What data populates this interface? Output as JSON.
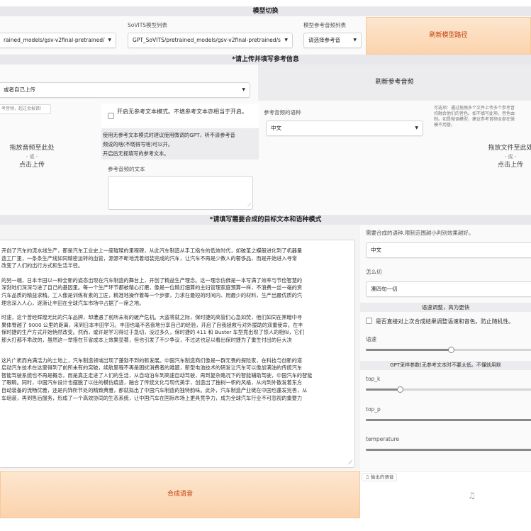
{
  "model_switch": {
    "header": "模型切换",
    "gpt_value": "rained_models/gsv-v2final-pretrained/",
    "sovits_label": "SoVITS模型列表",
    "sovits_value": "GPT_SoVITS/pretrained_models/gsv-v2final-pretrained/s",
    "ref_list_label": "模型参考音频列表",
    "ref_list_value": "请选择参考音",
    "refresh_models_button": "刷新模型路径"
  },
  "reference": {
    "header": "*请上传并填写参考信息",
    "dropdown_value": "或者自己上传",
    "refresh_ref_button": "刷新参考音频",
    "tooltip_text": "考音频，超过会报错！",
    "upload_main": "拖放音频至此处",
    "upload_or": "- 或 -",
    "upload_click": "点击上传",
    "no_ref_mode_label": "开启无参考文本模式。不填参考文本亦相当于开启。",
    "no_ref_info": [
      "使用无参考文本模式时建议使用微调的GPT，听不清参考音",
      "频说的啥(不晓得写啥)可以开。",
      "开启后无视填写的参考文本。"
    ],
    "ref_lang_label": "参考音频的语种",
    "ref_lang_value": "中文",
    "ref_text_label": "参考音频的文本",
    "multi_ref_tip": [
      "可选项：通过拖拽多个文件上传多个参考音",
      "均融合他们的音色。如不填写此项，音色由",
      "制。如是微调模型，建议参考音频全部在微",
      "模不用管。"
    ],
    "upload2_main": "拖放文件至此处",
    "upload2_or": "- 或 -",
    "upload2_click": "点击上传"
  },
  "synthesis": {
    "header": "*请填写需要合成的目标文本和语种模式",
    "paragraphs": [
      [
        "开创了汽车的流水线生产，那是汽车工业史上一座璀璨的里程碑，从此汽车制造从手工指车的低效时代，如破茧之蝶般进化到了机器量",
        "造工厂里，一条条生产线如同精密运转的血管，源源不断地流着组装完成的汽车，让汽车不再是少数人的奢侈品，而是开始进入寻常",
        "改变了人们的出行方式和生活半径。"
      ],
      [
        "的另一端，日本丰田以一种全新的姿态出现在汽车制造的舞台上，开创了精益生产理念。这一理念仿佛是一本写满了效率与节俭智慧的",
        "深刻地们深深与进了自己的基因里。每一个生产环节都被精心打磨，像是一位精打细算的主妇管理家庭预算一样，不浪费一丝一毫的资",
        "汽车品质的精益求精。工人像是训练有素的工匠，精准地操作着每一个步骤，力求在最短的时间内、用最少的材料，生产出最优质的汽",
        "理念深入人心，逐渐让丰田在全球汽车市场中占据了一席之地。"
      ],
      [
        "时速，这个曾经辉煌无比的汽车品牌，却遭遇了前所未有的破产危机。大盗将就之际，保时捷的高管们心急如焚，他们如同在黑暗中寻",
        "果体脊越了 9000 公里的距离，来到日本丰田学习。丰田也毫不吝啬地分享自己的经验，开启了自我拯救与对外援助的双重使命。在丰",
        "保时捷的生产方式开始悄然改变。然而，或许是学习得过于急切，没过多久，保时捷的 411 和 Buster 车型竟出现了惊人的相似，它们",
        "那大打都不乖改的，虽然这一举措在节省成本上效果显著，但也引发了不少争议，不过这也足以看出保时捷为了重生付出的巨大决"
      ],
      [
        "这片广袤而充满活力的土地上，汽车制造领域出现了蓬勃不到的新发展。中国汽车制造商们像是一群无畏的探险家，在科技与创新的道",
        "启动汽车技术在这里得到了前所未有的突破，续航里程不再是困扰消费者的难题，新型电池技术的研发让汽车可以像加满油的传统汽车",
        "智能驾驶系统也不再是概念，而是真正走进了人们的生活，从自动泊车到高速自动驾驶，再到复杂路况下的智能辅助驾驶，中国汽车的智能",
        "了眼睛。同时，中国汽车设计也摆脱了以往的模仿痕迹，融合了传统文化与现代美学，创造出了独树一帜的风格，从内到外散发着东方",
        "自动装备的流畅优雅，还是内饰所节处的精致典雅，那就拟出了中国汽车制造的独特韵味。此外，汽车制造产业链在中国也蓬发完善，从",
        "车组装，再到售后服务，形成了一个高效协同的生态系统，让中国汽车在国际市场上更具竞争力，成为全球汽车行业不可忽视的重要力"
      ]
    ],
    "target_lang_label": "需要合成的语种.限制范围越小判别效果越好。",
    "target_lang_value": "中文",
    "cut_label": "怎么切",
    "cut_value": "凑四句一切",
    "speed_header": "语速调整，高为更快",
    "freeze_label": "是否直接对上次合成结果调整语速和音色。防止随机性。",
    "speed_label": "语速",
    "speed_value": 0.5,
    "gpt_params_header": "GPT采样参数(无参考文本时不要太低。不懂就用默",
    "top_k_label": "top_k",
    "top_k_value": 0.2,
    "top_p_label": "top_p",
    "top_p_value": 1.0,
    "temperature_label": "temperature",
    "temperature_value": 1.0,
    "synth_button": "合成语音",
    "output_label": "输出的语音"
  },
  "icons": {
    "dropdown": "chevron-down-icon",
    "music": "music-note-icon",
    "resize": "resize-handle-icon"
  },
  "colors": {
    "orange_btn_bg": "#fbd3ad",
    "orange_btn_text": "#c2410c",
    "section_bar": "#e8e8ec",
    "panel_gray": "#f2f2f4"
  }
}
